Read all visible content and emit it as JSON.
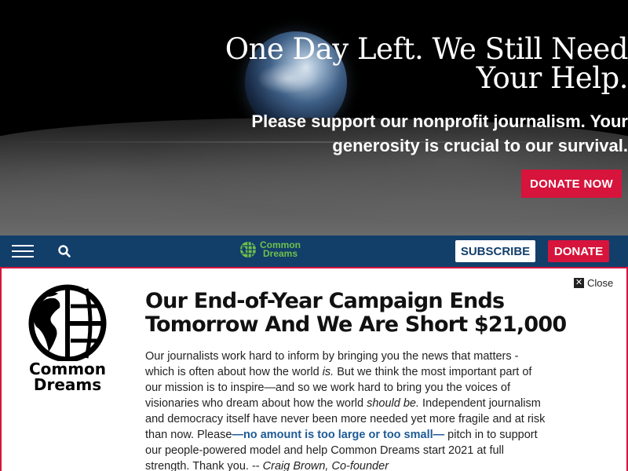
{
  "hero": {
    "title_line1": "One Day Left. We Still Need",
    "title_line2": "Your Help.",
    "sub_line1": "Please support our nonprofit journalism. Your",
    "sub_line2": "generosity is crucial to our survival.",
    "donate_label": "DONATE NOW"
  },
  "navbar": {
    "logo_line1": "Common",
    "logo_line2": "Dreams",
    "subscribe_label": "SUBSCRIBE",
    "donate_label": "DONATE"
  },
  "modal": {
    "close_label": "Close",
    "logo_line1": "Common",
    "logo_line2": "Dreams",
    "title_line1": "Our End-of-Year Campaign Ends",
    "title_line2": "Tomorrow And We Are Short $21,000",
    "body": {
      "p1": "Our journalists work hard to inform by bringing you the news that matters - which is often about how the world ",
      "em1": "is.",
      "p2": " But we think the most important part of our mission is to inspire—and so we work hard to bring you the voices of visionaries who dream about how the world ",
      "em2": "should be.",
      "p3": " Independent journalism and democracy itself have never been more needed yet more fragile and at risk than now. Please",
      "link": "—no amount is too large or too small—",
      "p4": " pitch in to support our people-powered model and help Common Dreams start 2021 at full strength. Thank you. -- ",
      "signature": "Craig Brown, Co-founder"
    }
  },
  "colors": {
    "accent_red": "#d6143c",
    "navy": "#123e6a",
    "logo_green": "#6fc04a",
    "link_blue": "#1e5b96"
  }
}
